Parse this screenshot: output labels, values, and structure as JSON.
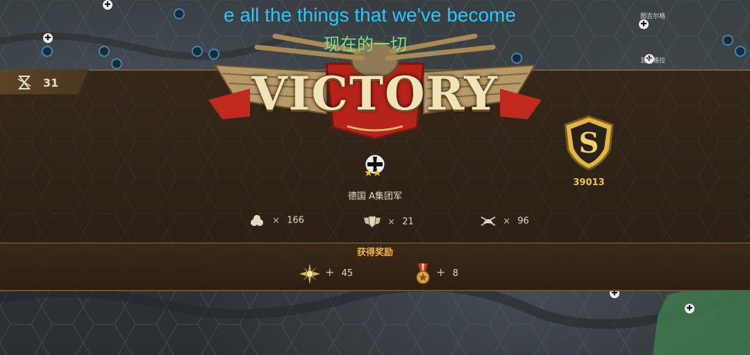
{
  "subtitles": {
    "english": "e all the things that we've become",
    "chinese": "现在的一切"
  },
  "turn": {
    "count": "31",
    "icon": "hourglass-icon"
  },
  "banner": {
    "title": "VICTORY"
  },
  "faction": {
    "name": "德国 A集团军",
    "stars": "★★",
    "emblem": "iron-cross-icon"
  },
  "rank": {
    "grade": "S",
    "score": "39013"
  },
  "stats": [
    {
      "icon": "resource-icon",
      "value": "166"
    },
    {
      "icon": "shield-wings-icon",
      "value": "21"
    },
    {
      "icon": "helmet-crossed-icon",
      "value": "96"
    }
  ],
  "rewards": {
    "title": "获得奖励",
    "items": [
      {
        "icon": "medal-star-icon",
        "value": "45"
      },
      {
        "icon": "ribbon-medal-icon",
        "value": "8"
      }
    ]
  },
  "map_labels": [
    "图吉尔格",
    "瓦尔格拉"
  ],
  "symbols": {
    "multiply": "×",
    "plus": "+"
  },
  "colors": {
    "subtitle_english": "#29c7ff",
    "subtitle_chinese": "#7fe38a",
    "score": "#f0c54a",
    "reward_title": "#f0b44a",
    "panel": "#34261a"
  }
}
